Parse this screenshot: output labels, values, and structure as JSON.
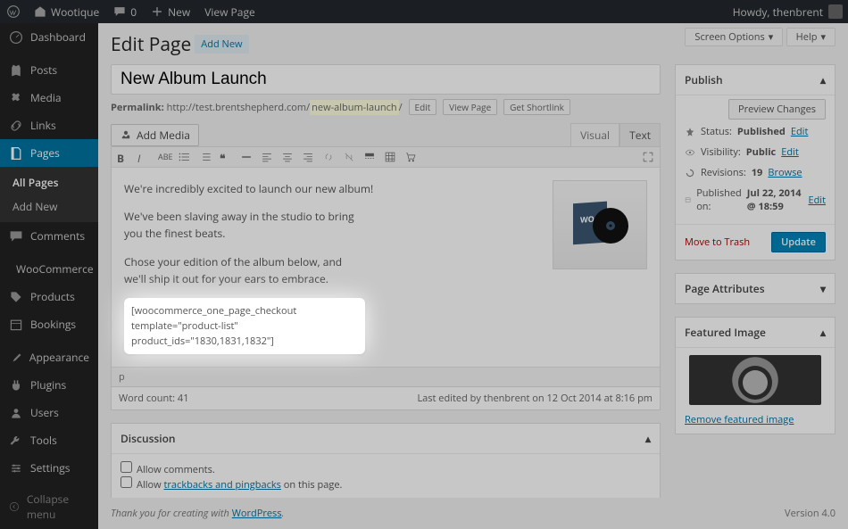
{
  "adminbar": {
    "site_name": "Wootique",
    "comments": "0",
    "new": "New",
    "view_page": "View Page",
    "howdy": "Howdy, thenbrent"
  },
  "sidebar": {
    "items": [
      {
        "label": "Dashboard",
        "icon": "dashboard"
      },
      {
        "label": "Posts",
        "icon": "pin"
      },
      {
        "label": "Media",
        "icon": "media"
      },
      {
        "label": "Links",
        "icon": "link"
      },
      {
        "label": "Pages",
        "icon": "page"
      },
      {
        "label": "Comments",
        "icon": "comment"
      },
      {
        "label": "WooCommerce",
        "icon": "woo"
      },
      {
        "label": "Products",
        "icon": "product"
      },
      {
        "label": "Bookings",
        "icon": "calendar"
      },
      {
        "label": "Appearance",
        "icon": "brush"
      },
      {
        "label": "Plugins",
        "icon": "plugin"
      },
      {
        "label": "Users",
        "icon": "user"
      },
      {
        "label": "Tools",
        "icon": "tool"
      },
      {
        "label": "Settings",
        "icon": "settings"
      }
    ],
    "sub": {
      "all": "All Pages",
      "add": "Add New"
    },
    "collapse": "Collapse menu"
  },
  "screen_options": "Screen Options",
  "help": "Help",
  "heading": "Edit Page",
  "add_new": "Add New",
  "title": "New Album Launch",
  "permalink": {
    "label": "Permalink:",
    "base": "http://test.brentshepherd.com/",
    "slug": "new-album-launch",
    "edit": "Edit",
    "view": "View Page",
    "short": "Get Shortlink"
  },
  "media_btn": "Add Media",
  "tabs": {
    "visual": "Visual",
    "text": "Text"
  },
  "content": {
    "p1": "We're incredibly excited to launch our new album!",
    "p2": "We've been slaving away in the studio to bring you the finest beats.",
    "p3": "Chose your edition of the album below, and we'll ship it out for your ears to embrace.",
    "shortcode": "[woocommerce_one_page_checkout template=\"product-list\" product_ids=\"1830,1831,1832\"]"
  },
  "statusbar": "p",
  "word_count": "Word count: 41",
  "last_edited": "Last edited by thenbrent on 12 Oct 2014 at 8:16 pm",
  "publish": {
    "title": "Publish",
    "preview": "Preview Changes",
    "status_l": "Status:",
    "status_v": "Published",
    "status_e": "Edit",
    "vis_l": "Visibility:",
    "vis_v": "Public",
    "vis_e": "Edit",
    "rev_l": "Revisions:",
    "rev_v": "19",
    "rev_b": "Browse",
    "pub_l": "Published on:",
    "pub_v": "Jul 22, 2014 @ 18:59",
    "pub_e": "Edit",
    "trash": "Move to Trash",
    "update": "Update"
  },
  "attrs": {
    "title": "Page Attributes"
  },
  "featured": {
    "title": "Featured Image",
    "remove": "Remove featured image"
  },
  "discussion": {
    "title": "Discussion",
    "allow_comments": "Allow comments.",
    "allow_1": "Allow ",
    "allow_link": "trackbacks and pingbacks",
    "allow_2": " on this page."
  },
  "footer": {
    "thanks": "Thank you for creating with ",
    "wp": "WordPress",
    "dot": ".",
    "version": "Version 4.0"
  }
}
